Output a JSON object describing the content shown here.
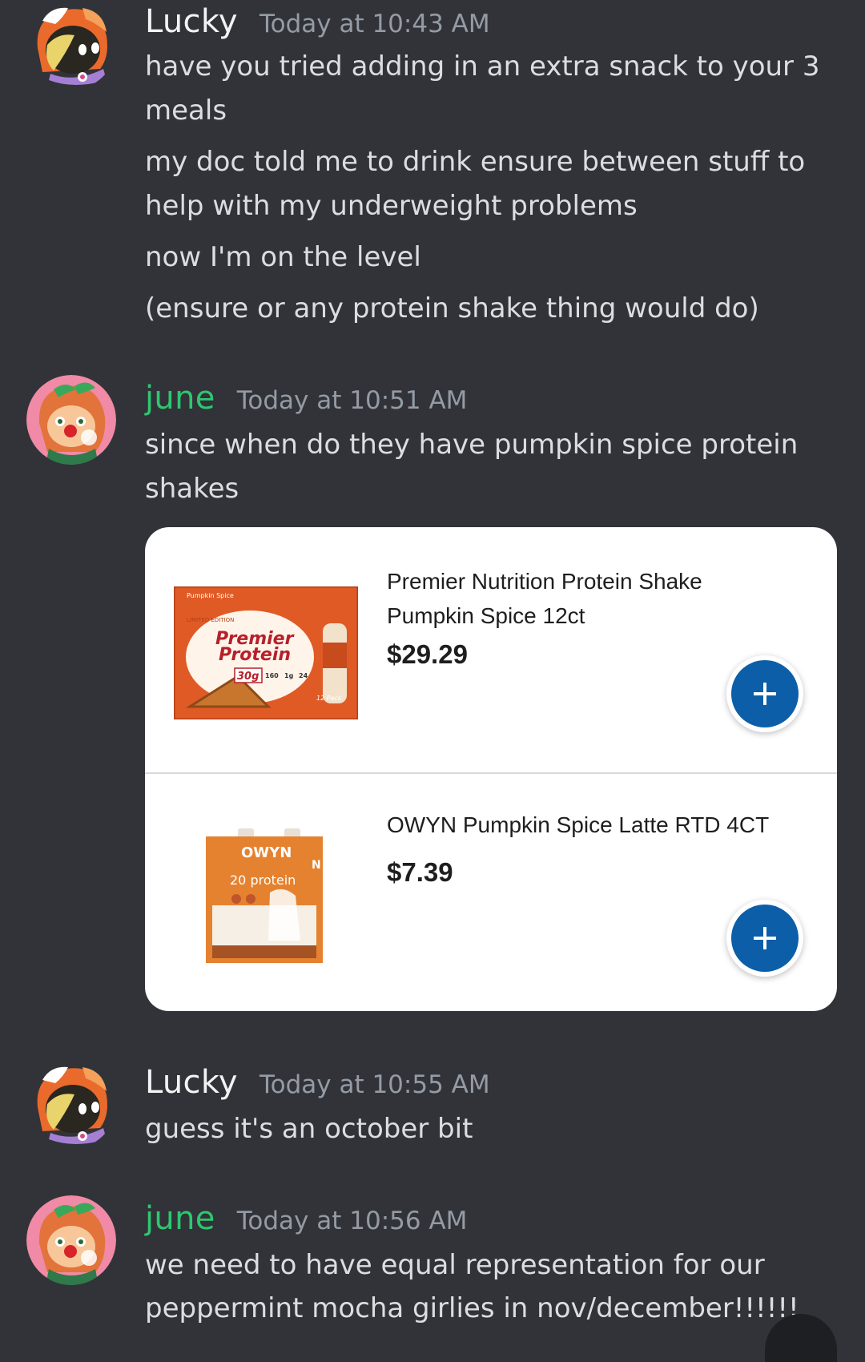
{
  "messages": [
    {
      "author": "Lucky",
      "timestamp": "Today at 10:43 AM",
      "lines": [
        "have you tried adding in an extra snack to your 3",
        "meals",
        "my doc told me to drink ensure between stuff to",
        "help with my underweight problems",
        "now I'm on the level",
        "(ensure or any protein shake thing would do)"
      ]
    },
    {
      "author": "june",
      "timestamp": "Today at 10:51 AM",
      "lines": [
        "since when do they have pumpkin spice protein",
        "shakes"
      ]
    },
    {
      "author": "Lucky",
      "timestamp": "Today at 10:55 AM",
      "lines": [
        "guess it's an october bit"
      ]
    },
    {
      "author": "june",
      "timestamp": "Today at 10:56 AM",
      "lines": [
        "we need to have equal representation for our",
        "peppermint mocha girlies in nov/december!!!!!!"
      ]
    }
  ],
  "products": [
    {
      "title_line1": "Premier Nutrition Protein Shake",
      "title_line2": "Pumpkin Spice 12ct",
      "price": "$29.29",
      "package": {
        "corner_label": "Pumpkin Spice",
        "badge": "LIMITED EDITION",
        "brand_line1": "Premier",
        "brand_line2": "Protein",
        "protein": "30g",
        "calories": "160",
        "sugar": "1g",
        "vitamins": "24",
        "pack": "12 Pack"
      }
    },
    {
      "title_line1": "OWYN Pumpkin Spice Latte RTD 4CT",
      "title_line2": "",
      "price": "$7.39",
      "package": {
        "brand": "OWYN",
        "protein": "20 protein",
        "side_letter": "N"
      }
    }
  ],
  "colors": {
    "background": "#313338",
    "june_name": "#2dc770",
    "lucky_name": "#f2f3f5",
    "timestamp": "#949ba4",
    "add_button": "#0b5ea7"
  },
  "icons": {
    "add": "plus-icon"
  }
}
